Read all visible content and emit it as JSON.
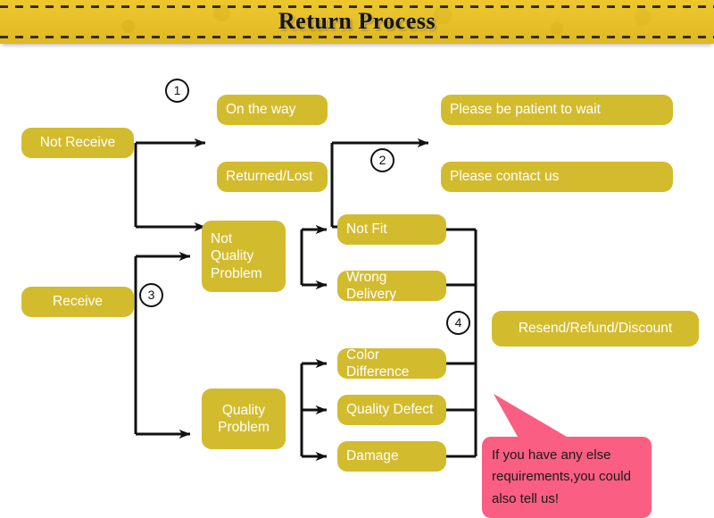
{
  "header": {
    "title": "Return Process",
    "banner_color": "#e6c029",
    "dash_color": "#3a2b08"
  },
  "theme": {
    "node_color": "#d3bb2e",
    "node_text_color": "#ffffff",
    "line_color": "#111111",
    "callout_color": "#fa5e82",
    "callout_text_color": "#1a1a1a",
    "page_background": "#ffffff"
  },
  "flow": {
    "nodes": {
      "not_receive": "Not Receive",
      "on_the_way": "On the way",
      "returned_lost": "Returned/Lost",
      "please_wait": "Please be patient to wait",
      "please_contact": "Please contact us",
      "receive": "Receive",
      "not_quality_problem": "Not\nQuality\nProblem",
      "quality_problem": "Quality\nProblem",
      "not_fit": "Not Fit",
      "wrong_delivery": "Wrong Delivery",
      "color_difference": "Color Difference",
      "quality_defect": "Quality Defect",
      "damage": "Damage",
      "resend_refund_discount": "Resend/Refund/Discount"
    },
    "step_markers": {
      "one": "1",
      "two": "2",
      "three": "3",
      "four": "4"
    }
  },
  "callout": {
    "text": "If you have any else requirements,you could also tell us!"
  }
}
